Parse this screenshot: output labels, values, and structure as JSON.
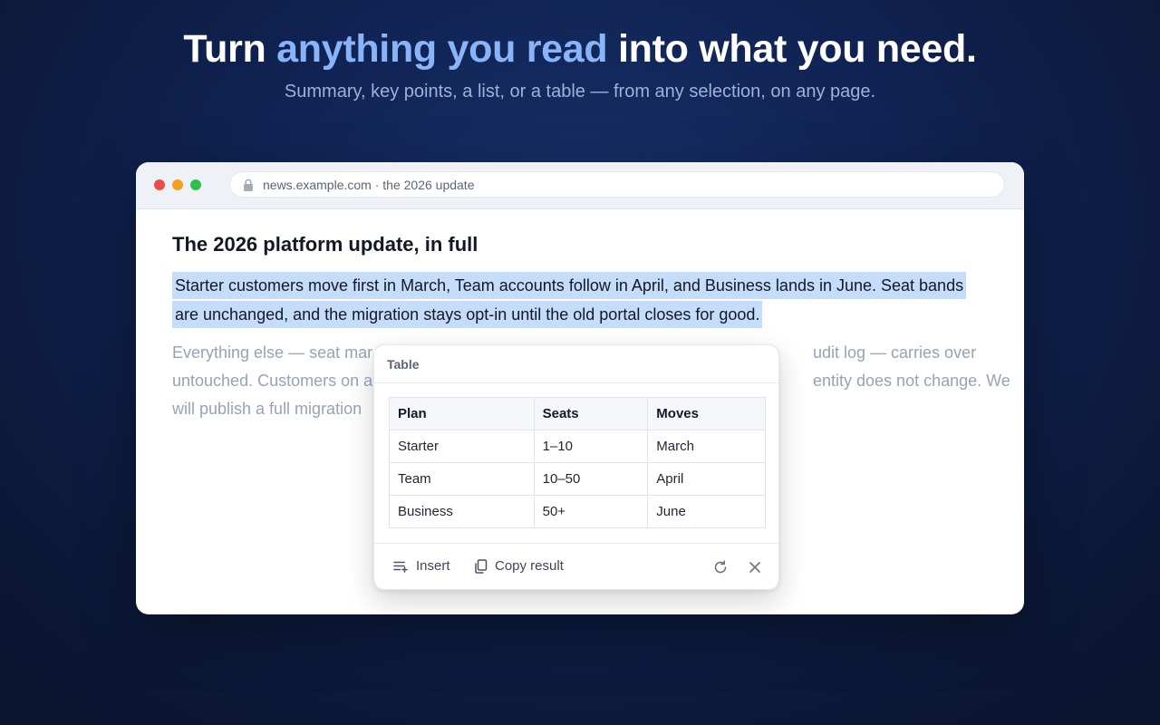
{
  "hero": {
    "title_start": "Turn ",
    "title_accent": "anything you read",
    "title_end": " into what you need.",
    "subtitle": "Summary, key points, a list, or a table — from any selection, on any page.",
    "accent_color": "#8ab4f8"
  },
  "browser": {
    "url": "news.example.com · the 2026 update",
    "lock_icon": "lock-icon"
  },
  "article": {
    "title": "The 2026 platform update, in full",
    "highlighted": "Starter customers move first in March, Team accounts follow in April, and Business lands in June. Seat bands are unchanged, and the migration stays opt-in until the old portal closes for good.",
    "faded_line1_left": "Everything else — seat mar",
    "faded_line1_right": "udit log — carries over",
    "faded_line2_left": "untouched. Customers on a",
    "faded_line2_right": "entity does not change. We",
    "faded_line3_left": "will publish a full migration"
  },
  "popup": {
    "title": "Table",
    "table": {
      "headers": [
        "Plan",
        "Seats",
        "Moves"
      ],
      "rows": [
        [
          "Starter",
          "1–10",
          "March"
        ],
        [
          "Team",
          "10–50",
          "April"
        ],
        [
          "Business",
          "50+",
          "June"
        ]
      ]
    },
    "insert_label": "Insert",
    "copy_label": "Copy result"
  }
}
